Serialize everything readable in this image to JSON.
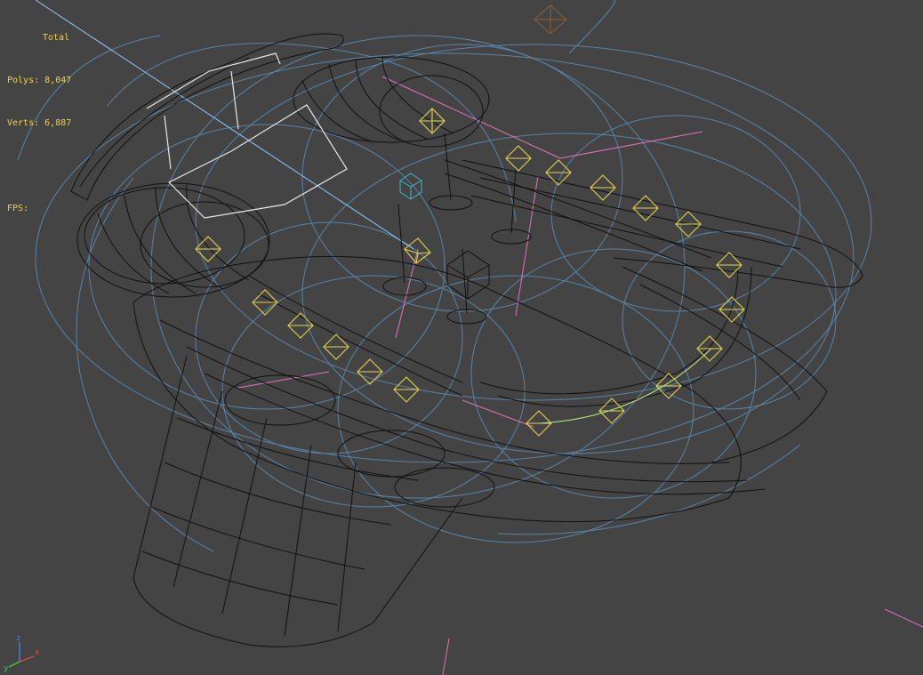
{
  "viewport": {
    "stats": {
      "total_label": "Total",
      "polys_label": "Polys:",
      "polys_value": "8,047",
      "verts_label": "Verts:",
      "verts_value": "6,887",
      "fps_label": "FPS:"
    },
    "gizmo": {
      "x_label": "x",
      "y_label": "y",
      "z_label": "z"
    },
    "colors": {
      "background": "#444444",
      "wireframe": "#111111",
      "light_helpers": "#5d8fb6",
      "selected_light": "#e3d44a",
      "guide_lines": "#e072b8",
      "camera_line": "#8fc8ff",
      "stats_text": "#f0d24a"
    }
  }
}
